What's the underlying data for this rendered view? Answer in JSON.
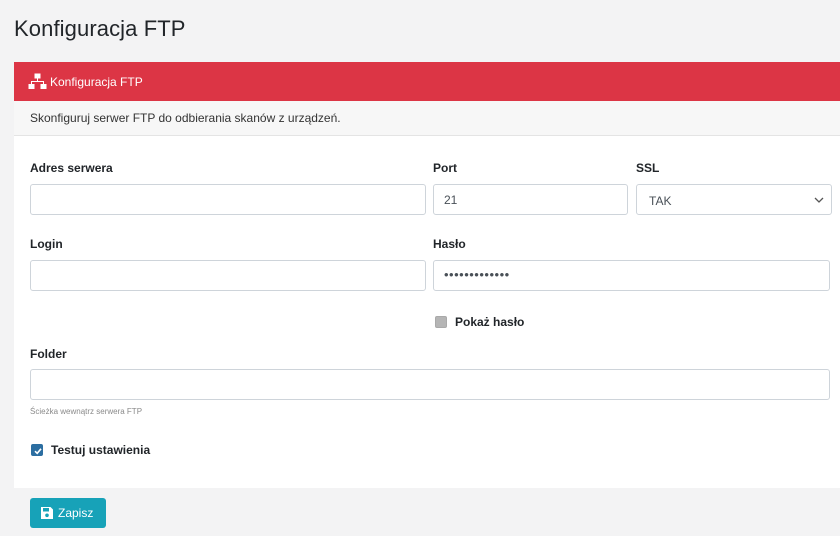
{
  "page": {
    "title": "Konfiguracja FTP"
  },
  "card": {
    "header": "Konfiguracja FTP",
    "description": "Skonfiguruj serwer FTP do odbierania skanów z urządzeń.",
    "colors": {
      "header": "#dc3545",
      "button": "#17a2b8"
    }
  },
  "form": {
    "server": {
      "label": "Adres serwera",
      "value": ""
    },
    "port": {
      "label": "Port",
      "value": "21"
    },
    "ssl": {
      "label": "SSL",
      "selected": "TAK"
    },
    "login": {
      "label": "Login",
      "value": ""
    },
    "password": {
      "label": "Hasło",
      "masked_value": "•••••••••••••"
    },
    "show_password": {
      "label": "Pokaż hasło",
      "checked": false
    },
    "folder": {
      "label": "Folder",
      "value": "",
      "help": "Ścieżka wewnątrz serwera FTP"
    },
    "test_settings": {
      "label": "Testuj ustawienia",
      "checked": true
    }
  },
  "footer": {
    "save_label": "Zapisz"
  },
  "icons": {
    "header": "network-icon",
    "save": "floppy-disk-icon",
    "select": "chevron-down-icon"
  }
}
